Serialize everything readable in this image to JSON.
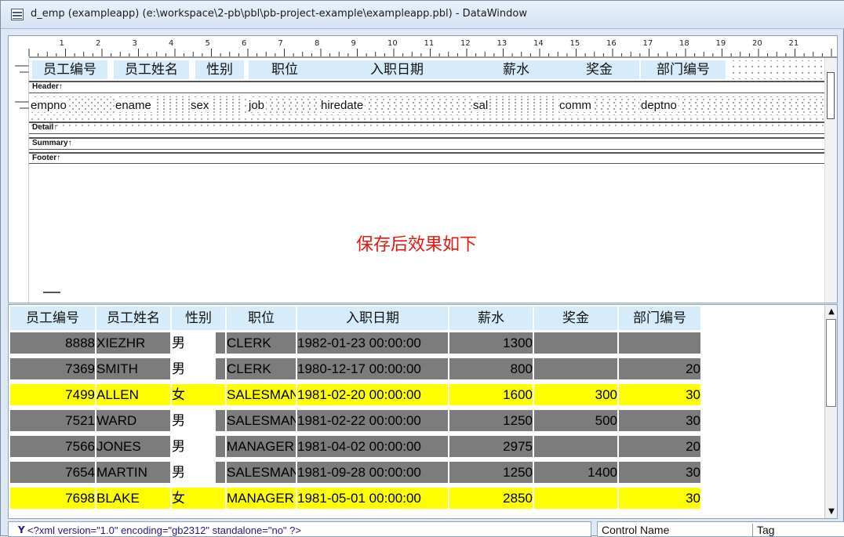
{
  "window": {
    "title": "d_emp  (exampleapp) (e:\\workspace\\2-pb\\pbl\\pb-project-example\\exampleapp.pbl) - DataWindow"
  },
  "ruler": {
    "numbers": [
      "1",
      "2",
      "3",
      "4",
      "5",
      "6",
      "7",
      "8",
      "9",
      "10",
      "11",
      "12",
      "13",
      "14",
      "15",
      "16",
      "17",
      "18",
      "19",
      "20",
      "21"
    ]
  },
  "design": {
    "header_labels": [
      "员工编号",
      "员工姓名",
      "性别",
      "职位",
      "入职日期",
      "薪水",
      "奖金",
      "部门编号"
    ],
    "detail_fields": [
      "empno",
      "ename",
      "sex",
      "job",
      "hiredate",
      "sal",
      "comm",
      "deptno"
    ],
    "bands": [
      "Header↑",
      "Detail↑",
      "Summary↑",
      "Footer↑"
    ],
    "annotation": "保存后效果如下"
  },
  "preview": {
    "columns": [
      "员工编号",
      "员工姓名",
      "性别",
      "职位",
      "入职日期",
      "薪水",
      "奖金",
      "部门编号"
    ],
    "rows": [
      {
        "empno": "8888",
        "ename": "XIEZHR",
        "sex": "男",
        "job": "CLERK",
        "hiredate": "1982-01-23 00:00:00",
        "sal": "1300",
        "comm": "",
        "deptno": "",
        "style": "gray"
      },
      {
        "empno": "7369",
        "ename": "SMITH",
        "sex": "男",
        "job": "CLERK",
        "hiredate": "1980-12-17 00:00:00",
        "sal": "800",
        "comm": "",
        "deptno": "20",
        "style": "gray"
      },
      {
        "empno": "7499",
        "ename": "ALLEN",
        "sex": "女",
        "job": "SALESMAN",
        "hiredate": "1981-02-20 00:00:00",
        "sal": "1600",
        "comm": "300",
        "deptno": "30",
        "style": "yellow"
      },
      {
        "empno": "7521",
        "ename": "WARD",
        "sex": "男",
        "job": "SALESMAN",
        "hiredate": "1981-02-22 00:00:00",
        "sal": "1250",
        "comm": "500",
        "deptno": "30",
        "style": "gray"
      },
      {
        "empno": "7566",
        "ename": "JONES",
        "sex": "男",
        "job": "MANAGER",
        "hiredate": "1981-04-02 00:00:00",
        "sal": "2975",
        "comm": "",
        "deptno": "20",
        "style": "gray"
      },
      {
        "empno": "7654",
        "ename": "MARTIN",
        "sex": "男",
        "job": "SALESMAN",
        "hiredate": "1981-09-28 00:00:00",
        "sal": "1250",
        "comm": "1400",
        "deptno": "30",
        "style": "gray"
      },
      {
        "empno": "7698",
        "ename": "BLAKE",
        "sex": "女",
        "job": "MANAGER",
        "hiredate": "1981-05-01 00:00:00",
        "sal": "2850",
        "comm": "",
        "deptno": "30",
        "style": "yellow"
      }
    ],
    "colors": {
      "gray": "#7c7c7c",
      "yellow": "#ffff00",
      "header": "#d7ecfa"
    }
  },
  "bottom": {
    "xml_text": "<?xml version=\"1.0\" encoding=\"gb2312\" standalone=\"no\" ?>",
    "props_columns": [
      "Control Name",
      "Tag"
    ]
  }
}
